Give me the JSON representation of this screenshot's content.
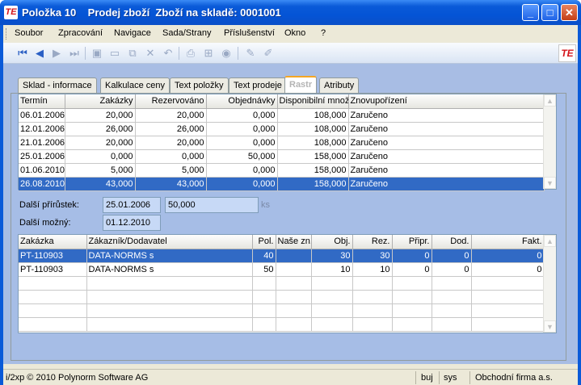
{
  "window": {
    "title": "Položka 10    Prodej zboží  Zboží na skladě: 0001001",
    "app_icon_text": "TE",
    "controls": {
      "minimize": "_",
      "maximize": "□",
      "close": "✕"
    }
  },
  "menu": [
    "Soubor",
    "Zpracování",
    "Navigace",
    "Sada/Strany",
    "Příslušenství",
    "Okno",
    "?"
  ],
  "toolbar": {
    "icons": [
      "first-record-icon",
      "prev-record-icon",
      "next-record-icon",
      "last-record-icon",
      "save-icon",
      "new-icon",
      "copy-icon",
      "delete-icon",
      "undo-icon",
      "print-icon",
      "tree-icon",
      "refresh-icon",
      "edit-icon",
      "edit2-icon"
    ],
    "brand": "TE"
  },
  "tabs": [
    {
      "label": "Sklad - informace",
      "active": false
    },
    {
      "label": "Kalkulace ceny",
      "active": false
    },
    {
      "label": "Text položky",
      "active": false
    },
    {
      "label": "Text prodeje",
      "active": false
    },
    {
      "label": "Rastr",
      "active": true
    },
    {
      "label": "Atributy",
      "active": false
    }
  ],
  "grid1": {
    "headers": [
      "Termín",
      "Zakázky",
      "Rezervováno",
      "Objednávky",
      "Disponibilní množ.",
      "Znovupořízení"
    ],
    "rows": [
      [
        "06.01.2006",
        "20,000",
        "20,000",
        "0,000",
        "108,000",
        "Zaručeno"
      ],
      [
        "12.01.2006",
        "26,000",
        "26,000",
        "0,000",
        "108,000",
        "Zaručeno"
      ],
      [
        "21.01.2006",
        "20,000",
        "20,000",
        "0,000",
        "108,000",
        "Zaručeno"
      ],
      [
        "25.01.2006",
        "0,000",
        "0,000",
        "50,000",
        "158,000",
        "Zaručeno"
      ],
      [
        "01.06.2010",
        "5,000",
        "5,000",
        "0,000",
        "158,000",
        "Zaručeno"
      ],
      [
        "26.08.2010",
        "43,000",
        "43,000",
        "0,000",
        "158,000",
        "Zaručeno"
      ]
    ],
    "selected_row": 5
  },
  "fields": {
    "next_increment_label": "Další přírůstek:",
    "next_increment_date": "25.01.2006",
    "next_increment_qty": "50,000",
    "unit": "ks",
    "next_possible_label": "Další možný:",
    "next_possible_date": "01.12.2010"
  },
  "grid2": {
    "headers": [
      "Zakázka",
      "Zákazník/Dodavatel",
      "Pol.",
      "Naše zn.",
      "Obj.",
      "Rez.",
      "Připr.",
      "Dod.",
      "Fakt."
    ],
    "rows": [
      [
        "PT-110903",
        "DATA-NORMS s",
        "40",
        "",
        "30",
        "30",
        "0",
        "0",
        "0"
      ],
      [
        "PT-110903",
        "DATA-NORMS s",
        "50",
        "",
        "10",
        "10",
        "0",
        "0",
        "0"
      ]
    ],
    "selected_row": 0
  },
  "status": {
    "copyright": "i/2xp © 2010 Polynorm Software AG",
    "user": "buj",
    "system": "sys",
    "company": "Obchodní firma a.s."
  }
}
